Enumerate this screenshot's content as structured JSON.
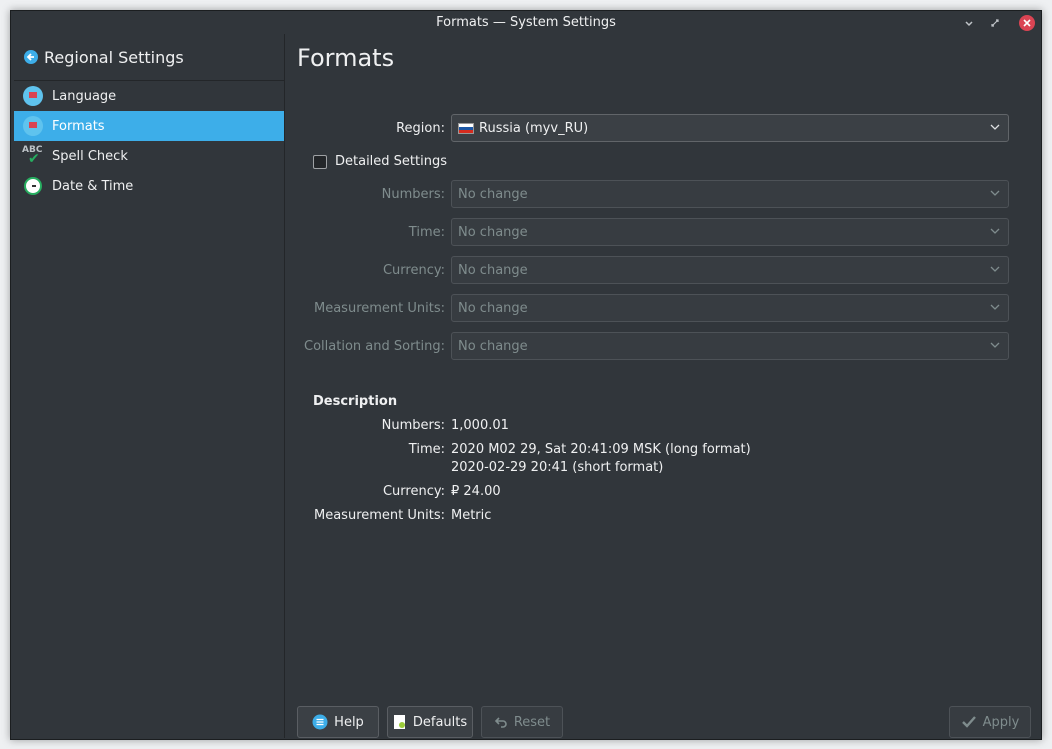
{
  "window": {
    "title": "Formats — System Settings"
  },
  "sidebar": {
    "title": "Regional Settings",
    "items": [
      {
        "label": "Language",
        "icon": "flag-icon",
        "active": false
      },
      {
        "label": "Formats",
        "icon": "flag-icon",
        "active": true
      },
      {
        "label": "Spell Check",
        "icon": "spellcheck-icon",
        "active": false
      },
      {
        "label": "Date & Time",
        "icon": "clock-icon",
        "active": false
      }
    ]
  },
  "main": {
    "title": "Formats",
    "region": {
      "label": "Region:",
      "value": "Russia (myv_RU)"
    },
    "detailed": {
      "label": "Detailed Settings",
      "checked": false
    },
    "fields": [
      {
        "label": "Numbers:",
        "value": "No change"
      },
      {
        "label": "Time:",
        "value": "No change"
      },
      {
        "label": "Currency:",
        "value": "No change"
      },
      {
        "label": "Measurement Units:",
        "value": "No change"
      },
      {
        "label": "Collation and Sorting:",
        "value": "No change"
      }
    ],
    "description": {
      "heading": "Description",
      "numbers_label": "Numbers:",
      "numbers_value": "1,000.01",
      "time_label": "Time:",
      "time_long": "2020 M02 29, Sat 20:41:09 MSK (long format)",
      "time_short": "2020-02-29 20:41 (short format)",
      "currency_label": "Currency:",
      "currency_value": "₽ 24.00",
      "units_label": "Measurement Units:",
      "units_value": "Metric"
    }
  },
  "footer": {
    "help": "Help",
    "defaults": "Defaults",
    "reset": "Reset",
    "apply": "Apply"
  },
  "colors": {
    "accent": "#3daee9",
    "background": "#31363b",
    "close": "#da4453"
  }
}
